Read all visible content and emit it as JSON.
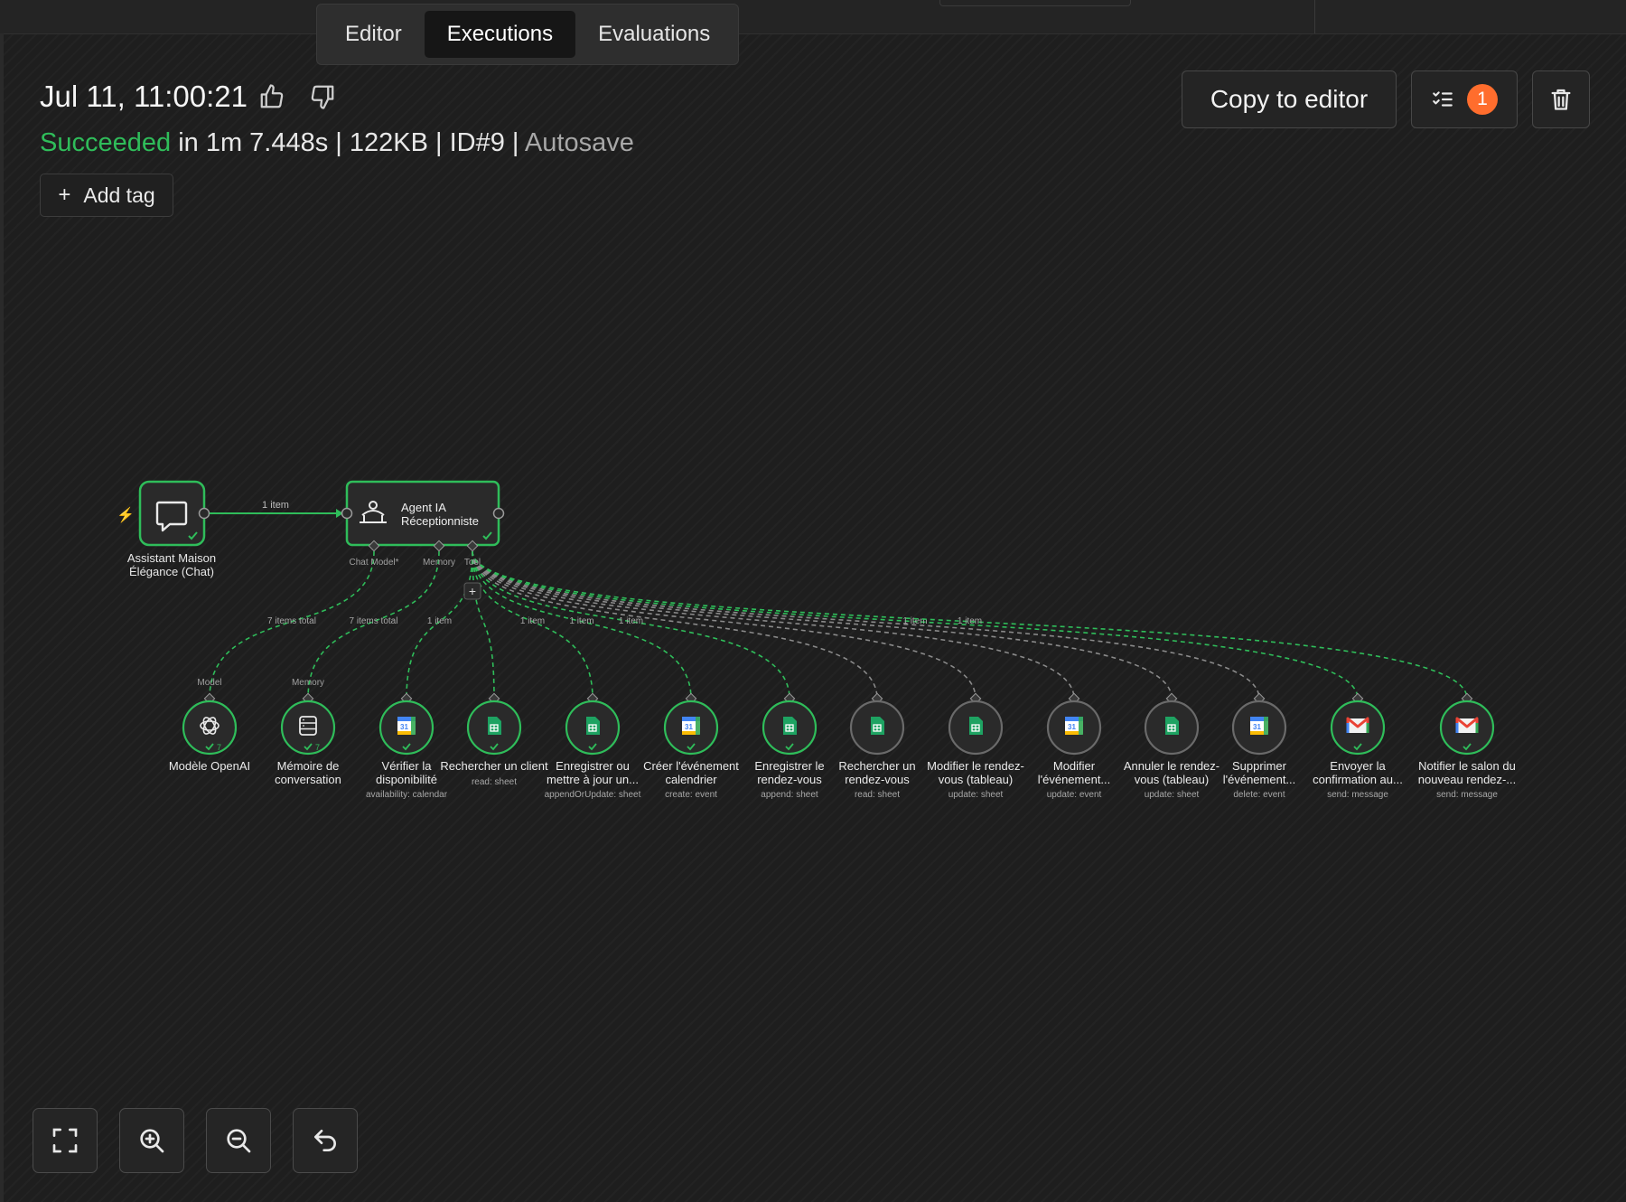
{
  "tabs": [
    "Editor",
    "Executions",
    "Evaluations"
  ],
  "execution": {
    "title": "Jul 11, 11:00:21",
    "status": "Succeeded",
    "details": "in 1m 7.448s | 122KB | ID#9 |",
    "mode": "Autosave",
    "add_tag": "Add tag"
  },
  "actions": {
    "copy_label": "Copy to editor",
    "tasks_count": "1"
  },
  "colors": {
    "success": "#2fbd5a",
    "accent": "#ff6d2d",
    "edge_idle": "#8a8a8a"
  },
  "workflow": {
    "trigger": {
      "label_line1": "Assistant Maison",
      "label_line2": "Élégance (Chat)",
      "icon": "chat-bubble-icon",
      "success": true
    },
    "main_edge_label": "1 item",
    "agent": {
      "label_line1": "Agent IA",
      "label_line2": "Réceptionniste",
      "icon": "robot-icon",
      "success": true
    },
    "ports": [
      "Chat Model*",
      "Memory",
      "Tool"
    ],
    "sub_nodes": [
      {
        "name": "Modèle OpenAI",
        "line2": "",
        "sub": "",
        "icon": "openai-icon",
        "success": true,
        "count": "7",
        "port_label": "Model",
        "edge_label": "7 items total"
      },
      {
        "name": "Mémoire de",
        "line2": "conversation",
        "sub": "",
        "icon": "database-icon",
        "success": true,
        "count": "7",
        "port_label": "Memory",
        "edge_label": "7 items total"
      },
      {
        "name": "Vérifier la",
        "line2": "disponibilité",
        "sub": "availability: calendar",
        "icon": "google-calendar-icon",
        "success": true,
        "edge_label": "1 item"
      },
      {
        "name": "Rechercher un client",
        "line2": "",
        "sub": "read: sheet",
        "icon": "google-sheets-icon",
        "success": true,
        "edge_label": ""
      },
      {
        "name": "Enregistrer ou",
        "line2": "mettre à jour un...",
        "sub": "appendOrUpdate: sheet",
        "icon": "google-sheets-icon",
        "success": true,
        "edge_label": "1 item"
      },
      {
        "name": "Créer l'événement",
        "line2": "calendrier",
        "sub": "create: event",
        "icon": "google-calendar-icon",
        "success": true,
        "edge_label": "1 item"
      },
      {
        "name": "Enregistrer le",
        "line2": "rendez-vous",
        "sub": "append: sheet",
        "icon": "google-sheets-icon",
        "success": true,
        "edge_label": "1 item"
      },
      {
        "name": "Rechercher un",
        "line2": "rendez-vous",
        "sub": "read: sheet",
        "icon": "google-sheets-icon",
        "success": false,
        "edge_label": ""
      },
      {
        "name": "Modifier le rendez-",
        "line2": "vous (tableau)",
        "sub": "update: sheet",
        "icon": "google-sheets-icon",
        "success": false,
        "edge_label": ""
      },
      {
        "name": "Modifier",
        "line2": "l'événement...",
        "sub": "update: event",
        "icon": "google-calendar-icon",
        "success": false,
        "edge_label": ""
      },
      {
        "name": "Annuler le rendez-",
        "line2": "vous (tableau)",
        "sub": "update: sheet",
        "icon": "google-sheets-icon",
        "success": false,
        "edge_label": ""
      },
      {
        "name": "Supprimer",
        "line2": "l'événement...",
        "sub": "delete: event",
        "icon": "google-calendar-icon",
        "success": false,
        "edge_label": ""
      },
      {
        "name": "Envoyer la",
        "line2": "confirmation au...",
        "sub": "send: message",
        "icon": "gmail-icon",
        "success": true,
        "edge_label": "1 item"
      },
      {
        "name": "Notifier le salon du",
        "line2": "nouveau rendez-...",
        "sub": "send: message",
        "icon": "gmail-icon",
        "success": true,
        "edge_label": "1 item"
      }
    ],
    "plus_label": "+"
  },
  "zoom_controls": [
    {
      "name": "fit-view-button",
      "icon": "fit-view-icon"
    },
    {
      "name": "zoom-in-button",
      "icon": "zoom-in-icon"
    },
    {
      "name": "zoom-out-button",
      "icon": "zoom-out-icon"
    },
    {
      "name": "reset-zoom-button",
      "icon": "undo-icon"
    }
  ]
}
